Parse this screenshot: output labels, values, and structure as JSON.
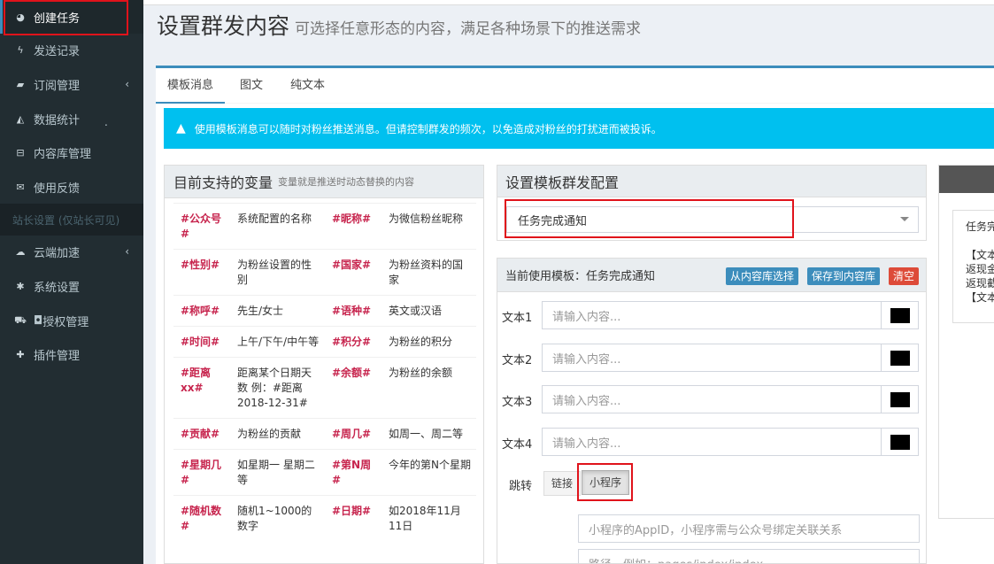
{
  "sidebar": {
    "items": [
      {
        "label": "创建任务",
        "icon": "dashboard-icon",
        "glyph": "◕"
      },
      {
        "label": "发送记录",
        "icon": "bolt-icon",
        "glyph": "ϟ"
      },
      {
        "label": "订阅管理",
        "icon": "book-icon",
        "glyph": "▰",
        "chevron": "‹"
      },
      {
        "label": "数据统计",
        "icon": "area-chart-icon",
        "glyph": "◭",
        "dot": "."
      },
      {
        "label": "内容库管理",
        "icon": "inbox-icon",
        "glyph": "⊟"
      },
      {
        "label": "使用反馈",
        "icon": "envelope-icon",
        "glyph": "✉"
      },
      {
        "label": "云端加速",
        "icon": "cloud-icon",
        "glyph": "☁",
        "chevron": "‹"
      },
      {
        "label": "系统设置",
        "icon": "asterisk-icon",
        "glyph": "✱"
      },
      {
        "label": "授权管理",
        "icon": "cart-icon",
        "glyph": "⛟",
        "prefix": "◘"
      },
      {
        "label": "插件管理",
        "icon": "puzzle-icon",
        "glyph": "✚"
      }
    ],
    "section_header": "站长设置 (仅站长可见)"
  },
  "header": {
    "title": "设置群发内容",
    "subtitle": "可选择任意形态的内容，满足各种场景下的推送需求"
  },
  "tabs": [
    {
      "label": "模板消息"
    },
    {
      "label": "图文"
    },
    {
      "label": "纯文本"
    }
  ],
  "alert": {
    "icon": "warning-icon",
    "glyph": "▲",
    "text": "使用模板消息可以随时对粉丝推送消息。但请控制群发的频次，以免造成对粉丝的打扰进而被投诉。"
  },
  "variables": {
    "title": "目前支持的变量",
    "subtitle": "变量就是推送时动态替换的内容",
    "rows": [
      {
        "k1": "#公众号#",
        "v1": "系统配置的名称",
        "k2": "#昵称#",
        "v2": "为微信粉丝昵称"
      },
      {
        "k1": "#性别#",
        "v1": "为粉丝设置的性别",
        "k2": "#国家#",
        "v2": "为粉丝资料的国家"
      },
      {
        "k1": "#称呼#",
        "v1": "先生/女士",
        "k2": "#语种#",
        "v2": "英文或汉语"
      },
      {
        "k1": "#时间#",
        "v1": "上午/下午/中午等",
        "k2": "#积分#",
        "v2": "为粉丝的积分"
      },
      {
        "k1": "#距离xx#",
        "v1": "距离某个日期天数 例：#距离2018-12-31#",
        "k2": "#余额#",
        "v2": "为粉丝的余额"
      },
      {
        "k1": "#贡献#",
        "v1": "为粉丝的贡献",
        "k2": "#周几#",
        "v2": "如周一、周二等"
      },
      {
        "k1": "#星期几#",
        "v1": "如星期一 星期二等",
        "k2": "#第N周#",
        "v2": "今年的第N个星期"
      },
      {
        "k1": "#随机数#",
        "v1": "随机1~1000的数字",
        "k2": "#日期#",
        "v2": "如2018年11月11日"
      }
    ]
  },
  "config": {
    "title": "设置模板群发配置",
    "selected": "任务完成通知"
  },
  "template": {
    "title": "当前使用模板：任务完成通知",
    "btn_select": "从内容库选择",
    "btn_save": "保存到内容库",
    "btn_clear": "清空",
    "fields": [
      {
        "label": "文本1",
        "placeholder": "请输入内容..."
      },
      {
        "label": "文本2",
        "placeholder": "请输入内容..."
      },
      {
        "label": "文本3",
        "placeholder": "请输入内容..."
      },
      {
        "label": "文本4",
        "placeholder": "请输入内容..."
      }
    ],
    "jump_label": "跳转",
    "jump_link": "链接",
    "jump_mini": "小程序",
    "appid_placeholder": "小程序的AppID，小程序需与公众号绑定关联关系",
    "path_placeholder": "路径，例如：pages/index/index"
  },
  "preview": {
    "lines": [
      "任务完",
      "",
      "【文本",
      "返现金",
      "返现截",
      "【文本"
    ]
  },
  "colors": {
    "accent": "#3c8dbc",
    "danger": "#dd4b39",
    "info": "#00c0ef",
    "highlight_box": "#e0131b"
  }
}
